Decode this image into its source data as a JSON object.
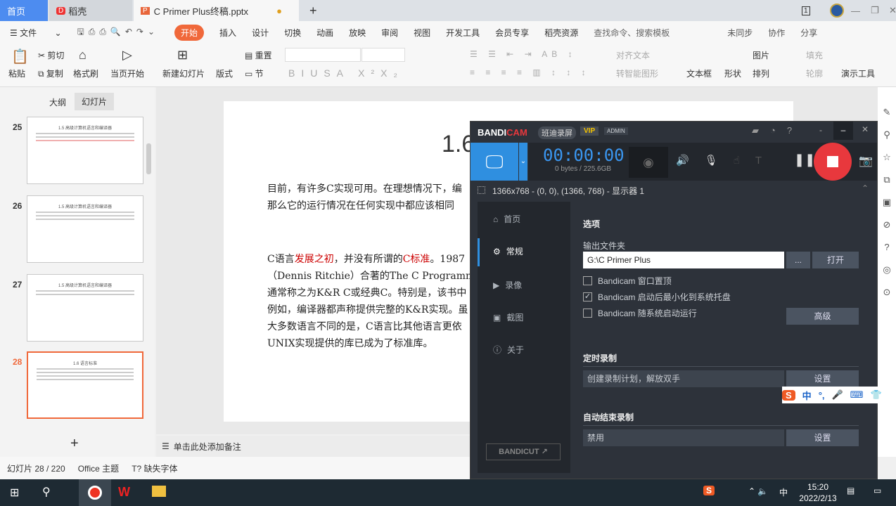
{
  "tabs": {
    "home": "首页",
    "daoke": "稻壳",
    "doc": "C Primer  Plus终稿.pptx",
    "new_tab": "+"
  },
  "window": {
    "badge": "1"
  },
  "menu": {
    "file": "文件",
    "items": [
      "开始",
      "插入",
      "设计",
      "切换",
      "动画",
      "放映",
      "审阅",
      "视图",
      "开发工具",
      "会员专享",
      "稻壳资源"
    ],
    "search": "查找命令、搜索模板",
    "sync": "未同步",
    "collab": "协作",
    "share": "分享"
  },
  "ribbon": {
    "paste": "粘贴",
    "cut": "剪切",
    "copy": "复制",
    "format_painter": "格式刷",
    "play_from_current": "当页开始",
    "new_slide": "新建幻灯片",
    "layout": "版式",
    "reset": "重置",
    "section": "节",
    "align_text": "对齐文本",
    "smart_art": "转智能图形",
    "textbox": "文本框",
    "shape": "形状",
    "picture": "图片",
    "fill": "填充",
    "arrange": "排列",
    "outline": "轮廓",
    "present_tools": "演示工具"
  },
  "left_panel": {
    "tab_outline": "大纲",
    "tab_slides": "幻灯片",
    "slides": [
      {
        "num": "25",
        "title": "1.5 高级计算机语言和编译器"
      },
      {
        "num": "26",
        "title": "1.5 高级计算机语言和编译器"
      },
      {
        "num": "27",
        "title": "1.5 高级计算机语言和编译器"
      },
      {
        "num": "28",
        "title": "1.6 语言标准"
      }
    ],
    "add": "+"
  },
  "slide": {
    "title": "1.6",
    "p1": [
      "目前，有许多C实现可用。在理想情况下，编",
      "那么它的运行情况在任何实现中都应该相同"
    ],
    "p2_a": "C语言",
    "p2_red1": "发展之初",
    "p2_b": "，并没有所谓的",
    "p2_red2": "C标准",
    "p2_c": "。1987",
    "p2": [
      "（Dennis Ritchie）合著的The C Programm",
      "通常称之为K&R C或经典C。特别是，该书中",
      "例如，编译器都声称提供完整的K&R实现。虽",
      "大多数语言不同的是，C语言比其他语言更依",
      "UNIX实现提供的库已成为了标准库。"
    ]
  },
  "notes": {
    "placeholder": "单击此处添加备注"
  },
  "status": {
    "slide": "幻灯片 28 / 220",
    "theme": "Office 主题",
    "missing_font": "缺失字体"
  },
  "bandicam": {
    "logo_a": "BANDI",
    "logo_b": "CAM",
    "cn_name": "班迪录屏",
    "vip": "VIP",
    "admin": "ADMIN",
    "timer": "00:00:00",
    "size": "0 bytes / 225.6GB",
    "region": "1366x768 - (0, 0), (1366, 768) - 显示器 1",
    "nav": [
      "首页",
      "常规",
      "录像",
      "截图",
      "关于"
    ],
    "options_title": "选项",
    "output_label": "输出文件夹",
    "output_value": "G:\\C Primer Plus",
    "browse": "...",
    "open": "打开",
    "checks": [
      {
        "label": "Bandicam 窗口置顶",
        "checked": false
      },
      {
        "label": "Bandicam 启动后最小化到系统托盘",
        "checked": true
      },
      {
        "label": "Bandicam 随系统启动运行",
        "checked": false
      }
    ],
    "advanced": "高级",
    "timer_title": "定时录制",
    "timer_value": "创建录制计划，解放双手",
    "settings": "设置",
    "auto_stop_title": "自动结束录制",
    "auto_stop_value": "禁用",
    "bandicut": "BANDICUT ↗",
    "colors": {
      "accent": "#2f8fe0",
      "record": "#e8383d"
    }
  },
  "ime": {
    "lang": "中",
    "punct": "°,"
  },
  "taskbar": {
    "time": "15:20",
    "date": "2022/2/13",
    "lang": "中"
  }
}
